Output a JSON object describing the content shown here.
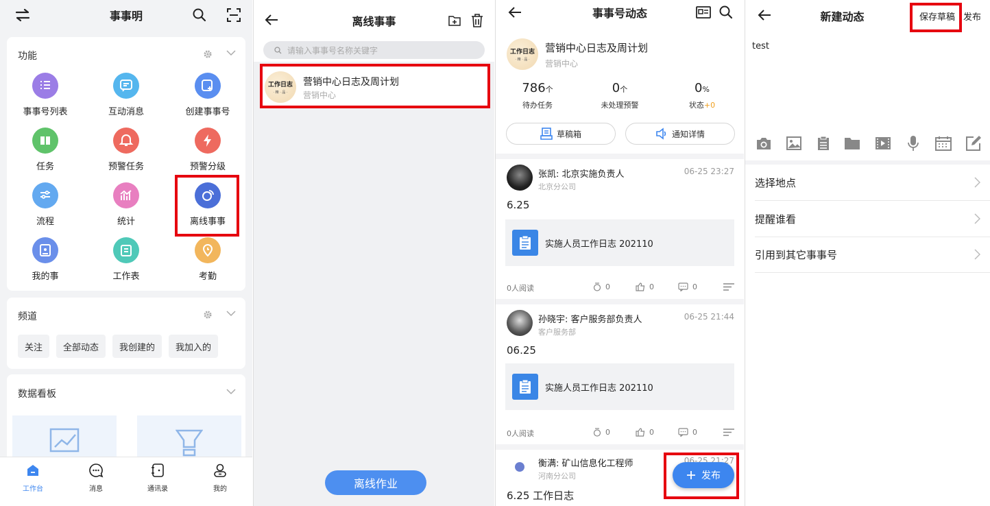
{
  "panel1": {
    "title": "事事明",
    "functions": {
      "title": "功能",
      "items": [
        {
          "label": "事事号列表",
          "color": "#9b7de6"
        },
        {
          "label": "互动消息",
          "color": "#55b6ee"
        },
        {
          "label": "创建事事号",
          "color": "#5a8ef0"
        },
        {
          "label": "任务",
          "color": "#5fc36a"
        },
        {
          "label": "预警任务",
          "color": "#ee6a5f"
        },
        {
          "label": "预警分级",
          "color": "#ee6a5f"
        },
        {
          "label": "流程",
          "color": "#63a9f0"
        },
        {
          "label": "统计",
          "color": "#e87fc0"
        },
        {
          "label": "离线事事",
          "color": "#4b6fd8"
        },
        {
          "label": "我的事",
          "color": "#6a8fea"
        },
        {
          "label": "工作表",
          "color": "#4fc9b8"
        },
        {
          "label": "考勤",
          "color": "#f2b65c"
        }
      ]
    },
    "channels": {
      "title": "频道",
      "chips": [
        "关注",
        "全部动态",
        "我创建的",
        "我加入的"
      ]
    },
    "dashboard": {
      "title": "数据看板"
    },
    "tabs": [
      "工作台",
      "消息",
      "通讯录",
      "我的"
    ],
    "accent": "#3d86ef"
  },
  "panel2": {
    "title": "离线事事",
    "search_placeholder": "请输入事事号名称关键字",
    "item": {
      "title": "营销中心日志及周计划",
      "sub": "营销中心",
      "avatar_text": "工作日志"
    },
    "bottom_button": "离线作业"
  },
  "panel3": {
    "title": "事事号动态",
    "header": {
      "title": "营销中心日志及周计划",
      "sub": "营销中心",
      "avatar_text": "工作日志"
    },
    "stats": [
      {
        "num": "786",
        "unit": "个",
        "label": "待办任务",
        "extra": ""
      },
      {
        "num": "0",
        "unit": "个",
        "label": "未处理预警",
        "extra": ""
      },
      {
        "num": "0",
        "unit": "%",
        "label": "状态",
        "extra": "+0"
      }
    ],
    "buttons": [
      "草稿箱",
      "通知详情"
    ],
    "posts": [
      {
        "name": "张凯: 北京实施负责人",
        "dept": "北京分公司",
        "time": "06-25 23:27",
        "body": "6.25",
        "attach": "实施人员工作日志 202110",
        "reads": "0人阅读",
        "c1": "0",
        "c2": "0",
        "c3": "0"
      },
      {
        "name": "孙晓宇: 客户服务部负责人",
        "dept": "客户服务部",
        "time": "06-25 21:44",
        "body": "06.25",
        "attach": "实施人员工作日志 202110",
        "reads": "0人阅读",
        "c1": "0",
        "c2": "0",
        "c3": "0"
      },
      {
        "name": "衡满: 矿山信息化工程师",
        "dept": "河南分公司",
        "time": "06-25 21:27",
        "body": "6.25 工作日志"
      }
    ],
    "fab": "发布"
  },
  "panel4": {
    "title": "新建动态",
    "save_draft": "保存草稿",
    "publish": "发布",
    "content": "test",
    "rows": [
      "选择地点",
      "提醒谁看",
      "引用到其它事事号"
    ]
  }
}
